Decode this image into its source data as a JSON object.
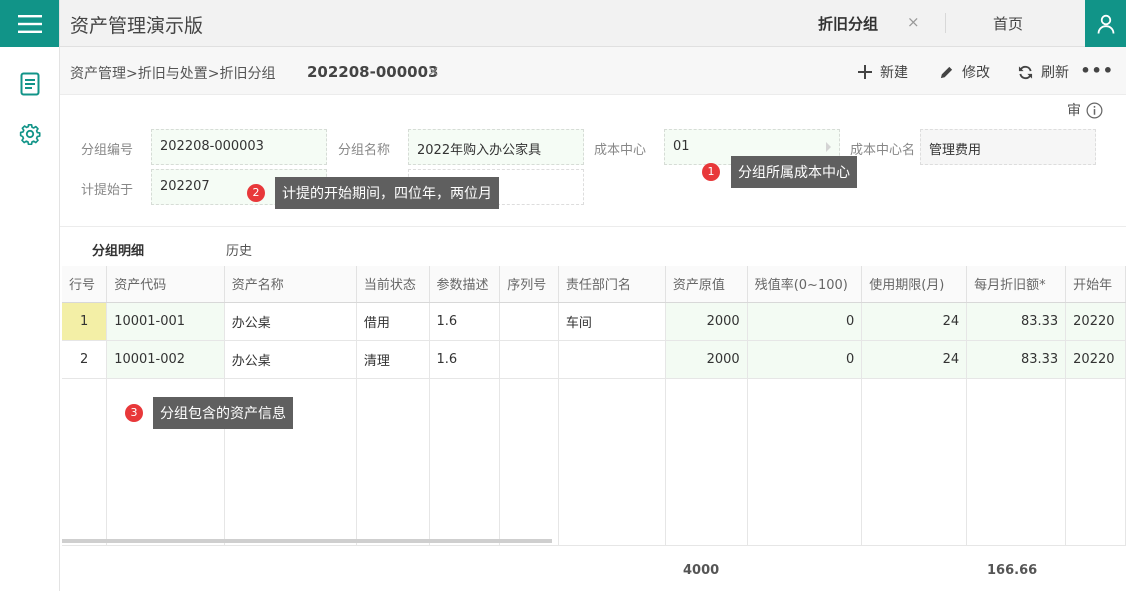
{
  "app": {
    "title": "资产管理演示版"
  },
  "tabs": {
    "active": "折旧分组",
    "home": "首页",
    "close": "×"
  },
  "breadcrumb": {
    "path": "资产管理>折旧与处置>折旧分组",
    "doc_no": "202208-000003",
    "close": "×"
  },
  "toolbar": {
    "new_label": "新建",
    "edit_label": "修改",
    "refresh_label": "刷新",
    "more": "•••"
  },
  "audit": {
    "label": "审"
  },
  "form": {
    "group_no": {
      "label": "分组编号",
      "value": "202208-000003"
    },
    "group_name": {
      "label": "分组名称",
      "value": "2022年购入办公家具"
    },
    "cost_center": {
      "label": "成本中心",
      "value": "01"
    },
    "cost_center_name": {
      "label": "成本中心名",
      "value": "管理费用"
    },
    "start_period": {
      "label": "计提始于",
      "value": "202207"
    }
  },
  "tooltips": [
    {
      "badge": "1",
      "text": "分组所属成本中心"
    },
    {
      "badge": "2",
      "text": "计提的开始期间，四位年，两位月"
    },
    {
      "badge": "3",
      "text": "分组包含的资产信息"
    }
  ],
  "detail_tabs": {
    "items": "分组明细",
    "history": "历史"
  },
  "table": {
    "headers": [
      "行号",
      "资产代码",
      "资产名称",
      "当前状态",
      "参数描述",
      "序列号",
      "责任部门名",
      "资产原值",
      "残值率(0~100)",
      "使用期限(月)",
      "每月折旧额*",
      "开始年"
    ],
    "rows": [
      [
        "1",
        "10001-001",
        "办公桌",
        "借用",
        "1.6",
        "",
        "车间",
        "2000",
        "0",
        "24",
        "83.33",
        "20220"
      ],
      [
        "2",
        "10001-002",
        "办公桌",
        "清理",
        "1.6",
        "",
        "",
        "2000",
        "0",
        "24",
        "83.33",
        "20220"
      ]
    ],
    "totals": {
      "original_value": "4000",
      "monthly_depreciation": "166.66"
    }
  },
  "colors": {
    "accent": "#119488",
    "tooltip_bg": "#5f5f5f",
    "badge": "#e8383a"
  },
  "icons": [
    "menu-icon",
    "document-icon",
    "gear-icon",
    "user-icon",
    "plus-icon",
    "pencil-icon",
    "refresh-icon",
    "info-icon"
  ]
}
